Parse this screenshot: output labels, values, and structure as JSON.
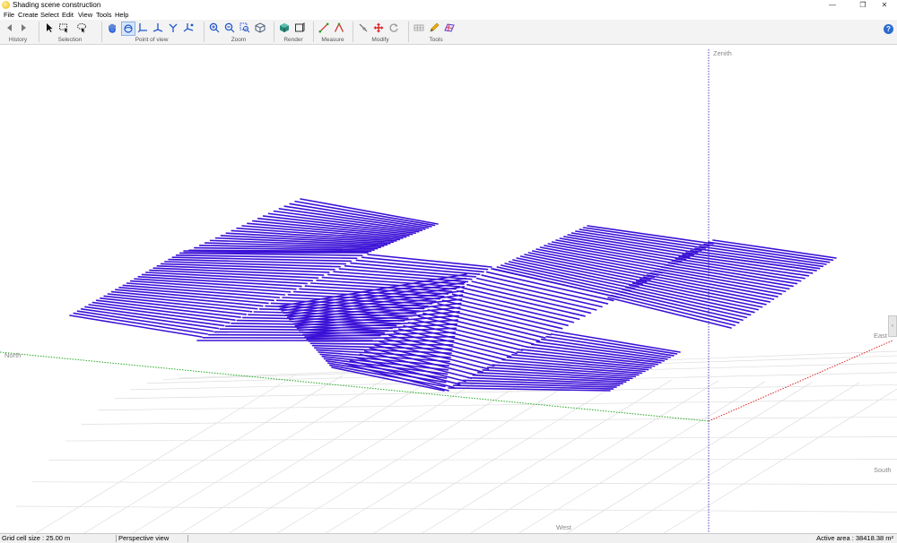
{
  "window": {
    "title": "Shading scene construction",
    "minimize": "—",
    "restore": "❐",
    "close": "✕"
  },
  "menu": [
    "File",
    "Create",
    "Select",
    "Edit",
    "View",
    "Tools",
    "Help"
  ],
  "toolbar": {
    "groups": [
      "History",
      "Selection",
      "Point of view",
      "Zoom",
      "Render",
      "Measure",
      "Modify",
      "Tools"
    ],
    "help": "?"
  },
  "viewport": {
    "axes": {
      "zenith": "Zenith",
      "north": "North",
      "east": "East",
      "south": "South",
      "west": "West"
    },
    "side_handle": "‹",
    "colors": {
      "rows": "#3a10d6",
      "row_edge": "#1a0a9a",
      "grid": "#dddddd",
      "north_axis": "#22aa22",
      "east_axis": "#dd2222",
      "zenith_axis": "#4444cc"
    }
  },
  "status": {
    "grid_cell": "Grid cell size : 25.00 m",
    "view_mode": "Perspective view",
    "active_area": "Active area : 38418.38 m²"
  }
}
